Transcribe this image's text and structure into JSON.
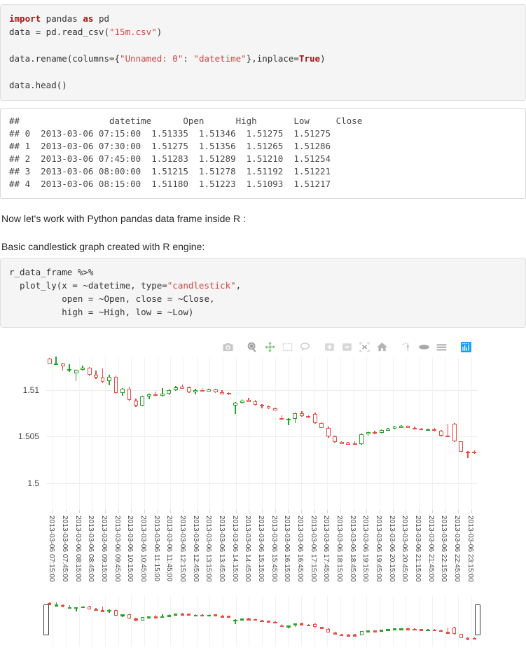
{
  "code_cell_1": {
    "lines": [
      {
        "segs": [
          {
            "t": "import",
            "c": "kw"
          },
          {
            "t": " pandas ",
            "c": ""
          },
          {
            "t": "as",
            "c": "kw"
          },
          {
            "t": " pd",
            "c": ""
          }
        ]
      },
      {
        "segs": [
          {
            "t": "data = pd.read_csv(",
            "c": ""
          },
          {
            "t": "\"15m.csv\"",
            "c": "str"
          },
          {
            "t": ")",
            "c": ""
          }
        ]
      },
      {
        "segs": [
          {
            "t": "",
            "c": ""
          }
        ]
      },
      {
        "segs": [
          {
            "t": "data.rename(columns={",
            "c": ""
          },
          {
            "t": "\"Unnamed: 0\"",
            "c": "str"
          },
          {
            "t": ": ",
            "c": ""
          },
          {
            "t": "\"datetime\"",
            "c": "str"
          },
          {
            "t": "},inplace=",
            "c": ""
          },
          {
            "t": "True",
            "c": "bool"
          },
          {
            "t": ")",
            "c": ""
          }
        ]
      },
      {
        "segs": [
          {
            "t": "",
            "c": ""
          }
        ]
      },
      {
        "segs": [
          {
            "t": "data.head()",
            "c": ""
          }
        ]
      }
    ]
  },
  "output_cell_1": {
    "header": "##                 datetime      Open      High       Low     Close",
    "rows": [
      "## 0  2013-03-06 07:15:00  1.51335  1.51346  1.51275  1.51275",
      "## 1  2013-03-06 07:30:00  1.51275  1.51356  1.51265  1.51286",
      "## 2  2013-03-06 07:45:00  1.51283  1.51289  1.51210  1.51254",
      "## 3  2013-03-06 08:00:00  1.51215  1.51278  1.51192  1.51221",
      "## 4  2013-03-06 08:15:00  1.51180  1.51223  1.51093  1.51217"
    ]
  },
  "prose": {
    "line1": "Now let's work with Python pandas data frame inside R :",
    "line2": "Basic candlestick graph created with R engine:"
  },
  "code_cell_2": {
    "lines": [
      {
        "segs": [
          {
            "t": "r_data_frame %>%",
            "c": ""
          }
        ]
      },
      {
        "segs": [
          {
            "t": "  plot_ly(x = ~datetime, type=",
            "c": ""
          },
          {
            "t": "\"candlestick\"",
            "c": "str"
          },
          {
            "t": ",",
            "c": ""
          }
        ]
      },
      {
        "segs": [
          {
            "t": "          open = ~Open, close = ~Close,",
            "c": ""
          }
        ]
      },
      {
        "segs": [
          {
            "t": "          high = ~High, low = ~Low)",
            "c": ""
          }
        ]
      }
    ]
  },
  "modebar": {
    "buttons": [
      {
        "name": "download-camera-icon",
        "title": "Download plot as a png",
        "active": false
      },
      {
        "name": "zoom-magnifier-icon",
        "title": "Zoom",
        "active": false
      },
      {
        "name": "pan-move-icon",
        "title": "Pan",
        "active": false
      },
      {
        "name": "box-select-icon",
        "title": "Box Select",
        "active": false
      },
      {
        "name": "lasso-select-icon",
        "title": "Lasso Select",
        "active": false
      },
      {
        "name": "zoom-in-icon",
        "title": "Zoom in",
        "active": false
      },
      {
        "name": "zoom-out-icon",
        "title": "Zoom out",
        "active": false
      },
      {
        "name": "autoscale-icon",
        "title": "Autoscale",
        "active": false
      },
      {
        "name": "reset-axes-home-icon",
        "title": "Reset axes",
        "active": false
      },
      {
        "name": "toggle-spike-lines-icon",
        "title": "Toggle Spike Lines",
        "active": false
      },
      {
        "name": "hover-closest-icon",
        "title": "Show closest data on hover",
        "active": false
      },
      {
        "name": "hover-compare-icon",
        "title": "Compare data on hover",
        "active": false
      },
      {
        "name": "plotly-logo-icon",
        "title": "Produced with Plotly",
        "active": true
      }
    ]
  },
  "chart_data": {
    "type": "candlestick",
    "title": "",
    "xlabel": "",
    "ylabel": "",
    "grid": true,
    "legend": false,
    "rangeslider": true,
    "ylim": [
      1.4973,
      1.5135
    ],
    "yticks": [
      "1.51",
      "1.505",
      "1.5"
    ],
    "ytickvals": [
      1.51,
      1.505,
      1.5
    ],
    "colors": {
      "increasing": "#ea4c46",
      "decreasing": "#2ca02c",
      "increasing_fill": "#ffffff",
      "decreasing_fill": "#ffffff",
      "grid": "#ececec",
      "background": "#ffffff",
      "accent": "#119dff",
      "tick_text": "#444444"
    },
    "xtick_labels": [
      "2013-03-06 07:15:00",
      "2013-03-06 07:45:00",
      "2013-03-06 08:15:00",
      "2013-03-06 08:45:00",
      "2013-03-06 09:15:00",
      "2013-03-06 09:45:00",
      "2013-03-06 10:15:00",
      "2013-03-06 10:45:00",
      "2013-03-06 11:15:00",
      "2013-03-06 11:45:00",
      "2013-03-06 12:15:00",
      "2013-03-06 12:45:00",
      "2013-03-06 13:15:00",
      "2013-03-06 13:45:00",
      "2013-03-06 14:15:00",
      "2013-03-06 14:45:00",
      "2013-03-06 15:15:00",
      "2013-03-06 15:45:00",
      "2013-03-06 16:15:00",
      "2013-03-06 16:45:00",
      "2013-03-06 17:15:00",
      "2013-03-06 17:45:00",
      "2013-03-06 18:15:00",
      "2013-03-06 18:45:00",
      "2013-03-06 19:15:00",
      "2013-03-06 19:45:00",
      "2013-03-06 20:15:00",
      "2013-03-06 20:45:00",
      "2013-03-06 21:15:00",
      "2013-03-06 21:45:00",
      "2013-03-06 22:15:00",
      "2013-03-06 22:45:00",
      "2013-03-06 23:15:00"
    ],
    "candles": [
      {
        "t": "07:15",
        "o": 1.51335,
        "h": 1.51346,
        "l": 1.51275,
        "c": 1.51275
      },
      {
        "t": "07:30",
        "o": 1.51275,
        "h": 1.51356,
        "l": 1.51265,
        "c": 1.51286
      },
      {
        "t": "07:45",
        "o": 1.51283,
        "h": 1.51289,
        "l": 1.5121,
        "c": 1.51254
      },
      {
        "t": "08:00",
        "o": 1.51215,
        "h": 1.51278,
        "l": 1.51192,
        "c": 1.51221
      },
      {
        "t": "08:15",
        "o": 1.5118,
        "h": 1.51223,
        "l": 1.51093,
        "c": 1.51217
      },
      {
        "t": "08:30",
        "o": 1.51218,
        "h": 1.51262,
        "l": 1.51205,
        "c": 1.5124
      },
      {
        "t": "08:45",
        "o": 1.5124,
        "h": 1.51248,
        "l": 1.5115,
        "c": 1.5116
      },
      {
        "t": "09:00",
        "o": 1.51162,
        "h": 1.51205,
        "l": 1.5112,
        "c": 1.51135
      },
      {
        "t": "09:15",
        "o": 1.51136,
        "h": 1.51228,
        "l": 1.51075,
        "c": 1.5109
      },
      {
        "t": "09:30",
        "o": 1.51092,
        "h": 1.5116,
        "l": 1.51048,
        "c": 1.5114
      },
      {
        "t": "09:45",
        "o": 1.51142,
        "h": 1.51158,
        "l": 1.5095,
        "c": 1.50965
      },
      {
        "t": "10:00",
        "o": 1.50965,
        "h": 1.5102,
        "l": 1.5094,
        "c": 1.5101
      },
      {
        "t": "10:15",
        "o": 1.51012,
        "h": 1.51035,
        "l": 1.5088,
        "c": 1.5089
      },
      {
        "t": "10:30",
        "o": 1.50888,
        "h": 1.50905,
        "l": 1.5082,
        "c": 1.50832
      },
      {
        "t": "10:45",
        "o": 1.50834,
        "h": 1.50935,
        "l": 1.50828,
        "c": 1.5093
      },
      {
        "t": "11:00",
        "o": 1.5093,
        "h": 1.50962,
        "l": 1.509,
        "c": 1.50952
      },
      {
        "t": "11:15",
        "o": 1.50952,
        "h": 1.50985,
        "l": 1.5093,
        "c": 1.5094
      },
      {
        "t": "11:30",
        "o": 1.5094,
        "h": 1.51018,
        "l": 1.50932,
        "c": 1.5096
      },
      {
        "t": "11:45",
        "o": 1.50962,
        "h": 1.5101,
        "l": 1.50945,
        "c": 1.50995
      },
      {
        "t": "12:00",
        "o": 1.50998,
        "h": 1.51042,
        "l": 1.50988,
        "c": 1.5103
      },
      {
        "t": "12:15",
        "o": 1.51032,
        "h": 1.5106,
        "l": 1.5102,
        "c": 1.51026
      },
      {
        "t": "12:30",
        "o": 1.51026,
        "h": 1.51035,
        "l": 1.50965,
        "c": 1.50975
      },
      {
        "t": "12:45",
        "o": 1.50978,
        "h": 1.51015,
        "l": 1.50955,
        "c": 1.50998
      },
      {
        "t": "13:00",
        "o": 1.51,
        "h": 1.51018,
        "l": 1.50985,
        "c": 1.50995
      },
      {
        "t": "13:15",
        "o": 1.50996,
        "h": 1.51012,
        "l": 1.50988,
        "c": 1.51002
      },
      {
        "t": "13:30",
        "o": 1.51004,
        "h": 1.51012,
        "l": 1.50965,
        "c": 1.50972
      },
      {
        "t": "13:45",
        "o": 1.50972,
        "h": 1.50996,
        "l": 1.50952,
        "c": 1.50966
      },
      {
        "t": "14:00",
        "o": 1.50966,
        "h": 1.50974,
        "l": 1.50945,
        "c": 1.5095
      },
      {
        "t": "14:15",
        "o": 1.50835,
        "h": 1.5087,
        "l": 1.5074,
        "c": 1.50862
      },
      {
        "t": "14:30",
        "o": 1.50862,
        "h": 1.509,
        "l": 1.50845,
        "c": 1.50888
      },
      {
        "t": "14:45",
        "o": 1.5089,
        "h": 1.50912,
        "l": 1.50875,
        "c": 1.50878
      },
      {
        "t": "15:00",
        "o": 1.50878,
        "h": 1.5089,
        "l": 1.5083,
        "c": 1.50838
      },
      {
        "t": "15:15",
        "o": 1.50838,
        "h": 1.50845,
        "l": 1.508,
        "c": 1.50828
      },
      {
        "t": "15:30",
        "o": 1.50828,
        "h": 1.50836,
        "l": 1.50792,
        "c": 1.508
      },
      {
        "t": "15:45",
        "o": 1.508,
        "h": 1.50812,
        "l": 1.50782,
        "c": 1.5079
      },
      {
        "t": "16:00",
        "o": 1.507,
        "h": 1.5073,
        "l": 1.50675,
        "c": 1.5068
      },
      {
        "t": "16:15",
        "o": 1.5068,
        "h": 1.507,
        "l": 1.5062,
        "c": 1.50692
      },
      {
        "t": "16:30",
        "o": 1.50692,
        "h": 1.5076,
        "l": 1.50648,
        "c": 1.50752
      },
      {
        "t": "16:45",
        "o": 1.50752,
        "h": 1.5077,
        "l": 1.50712,
        "c": 1.50718
      },
      {
        "t": "17:00",
        "o": 1.50718,
        "h": 1.5073,
        "l": 1.507,
        "c": 1.50706
      },
      {
        "t": "17:15",
        "o": 1.5074,
        "h": 1.5076,
        "l": 1.5064,
        "c": 1.50648
      },
      {
        "t": "17:30",
        "o": 1.50648,
        "h": 1.50662,
        "l": 1.5059,
        "c": 1.50596
      },
      {
        "t": "17:45",
        "o": 1.50596,
        "h": 1.5061,
        "l": 1.5049,
        "c": 1.505
      },
      {
        "t": "18:00",
        "o": 1.505,
        "h": 1.50512,
        "l": 1.50432,
        "c": 1.5044
      },
      {
        "t": "18:15",
        "o": 1.5044,
        "h": 1.50452,
        "l": 1.5042,
        "c": 1.50432
      },
      {
        "t": "18:30",
        "o": 1.50432,
        "h": 1.50445,
        "l": 1.50415,
        "c": 1.50428
      },
      {
        "t": "18:45",
        "o": 1.5043,
        "h": 1.50448,
        "l": 1.5041,
        "c": 1.5042
      },
      {
        "t": "19:00",
        "o": 1.5042,
        "h": 1.5053,
        "l": 1.50412,
        "c": 1.50522
      },
      {
        "t": "19:15",
        "o": 1.50522,
        "h": 1.50552,
        "l": 1.5051,
        "c": 1.50545
      },
      {
        "t": "19:30",
        "o": 1.50548,
        "h": 1.5056,
        "l": 1.50528,
        "c": 1.50535
      },
      {
        "t": "19:45",
        "o": 1.5054,
        "h": 1.50575,
        "l": 1.50532,
        "c": 1.50568
      },
      {
        "t": "20:00",
        "o": 1.50568,
        "h": 1.5059,
        "l": 1.5056,
        "c": 1.50582
      },
      {
        "t": "20:15",
        "o": 1.50585,
        "h": 1.50612,
        "l": 1.50578,
        "c": 1.50605
      },
      {
        "t": "20:30",
        "o": 1.50605,
        "h": 1.5062,
        "l": 1.50598,
        "c": 1.50612
      },
      {
        "t": "20:45",
        "o": 1.50612,
        "h": 1.50625,
        "l": 1.5059,
        "c": 1.50596
      },
      {
        "t": "21:00",
        "o": 1.50596,
        "h": 1.50605,
        "l": 1.50578,
        "c": 1.50585
      },
      {
        "t": "21:15",
        "o": 1.50585,
        "h": 1.50592,
        "l": 1.5057,
        "c": 1.50574
      },
      {
        "t": "21:30",
        "o": 1.50576,
        "h": 1.50588,
        "l": 1.50565,
        "c": 1.5058
      },
      {
        "t": "21:45",
        "o": 1.5058,
        "h": 1.5059,
        "l": 1.50555,
        "c": 1.5056
      },
      {
        "t": "22:00",
        "o": 1.5056,
        "h": 1.50568,
        "l": 1.50502,
        "c": 1.5051
      },
      {
        "t": "22:15",
        "o": 1.50512,
        "h": 1.5064,
        "l": 1.50495,
        "c": 1.50505
      },
      {
        "t": "22:30",
        "o": 1.5064,
        "h": 1.50648,
        "l": 1.5044,
        "c": 1.50448
      },
      {
        "t": "22:45",
        "o": 1.50448,
        "h": 1.50452,
        "l": 1.5033,
        "c": 1.50338
      },
      {
        "t": "23:00",
        "o": 1.50338,
        "h": 1.50348,
        "l": 1.5027,
        "c": 1.50332
      },
      {
        "t": "23:15",
        "o": 1.5034,
        "h": 1.5035,
        "l": 1.50318,
        "c": 1.50325
      }
    ]
  }
}
